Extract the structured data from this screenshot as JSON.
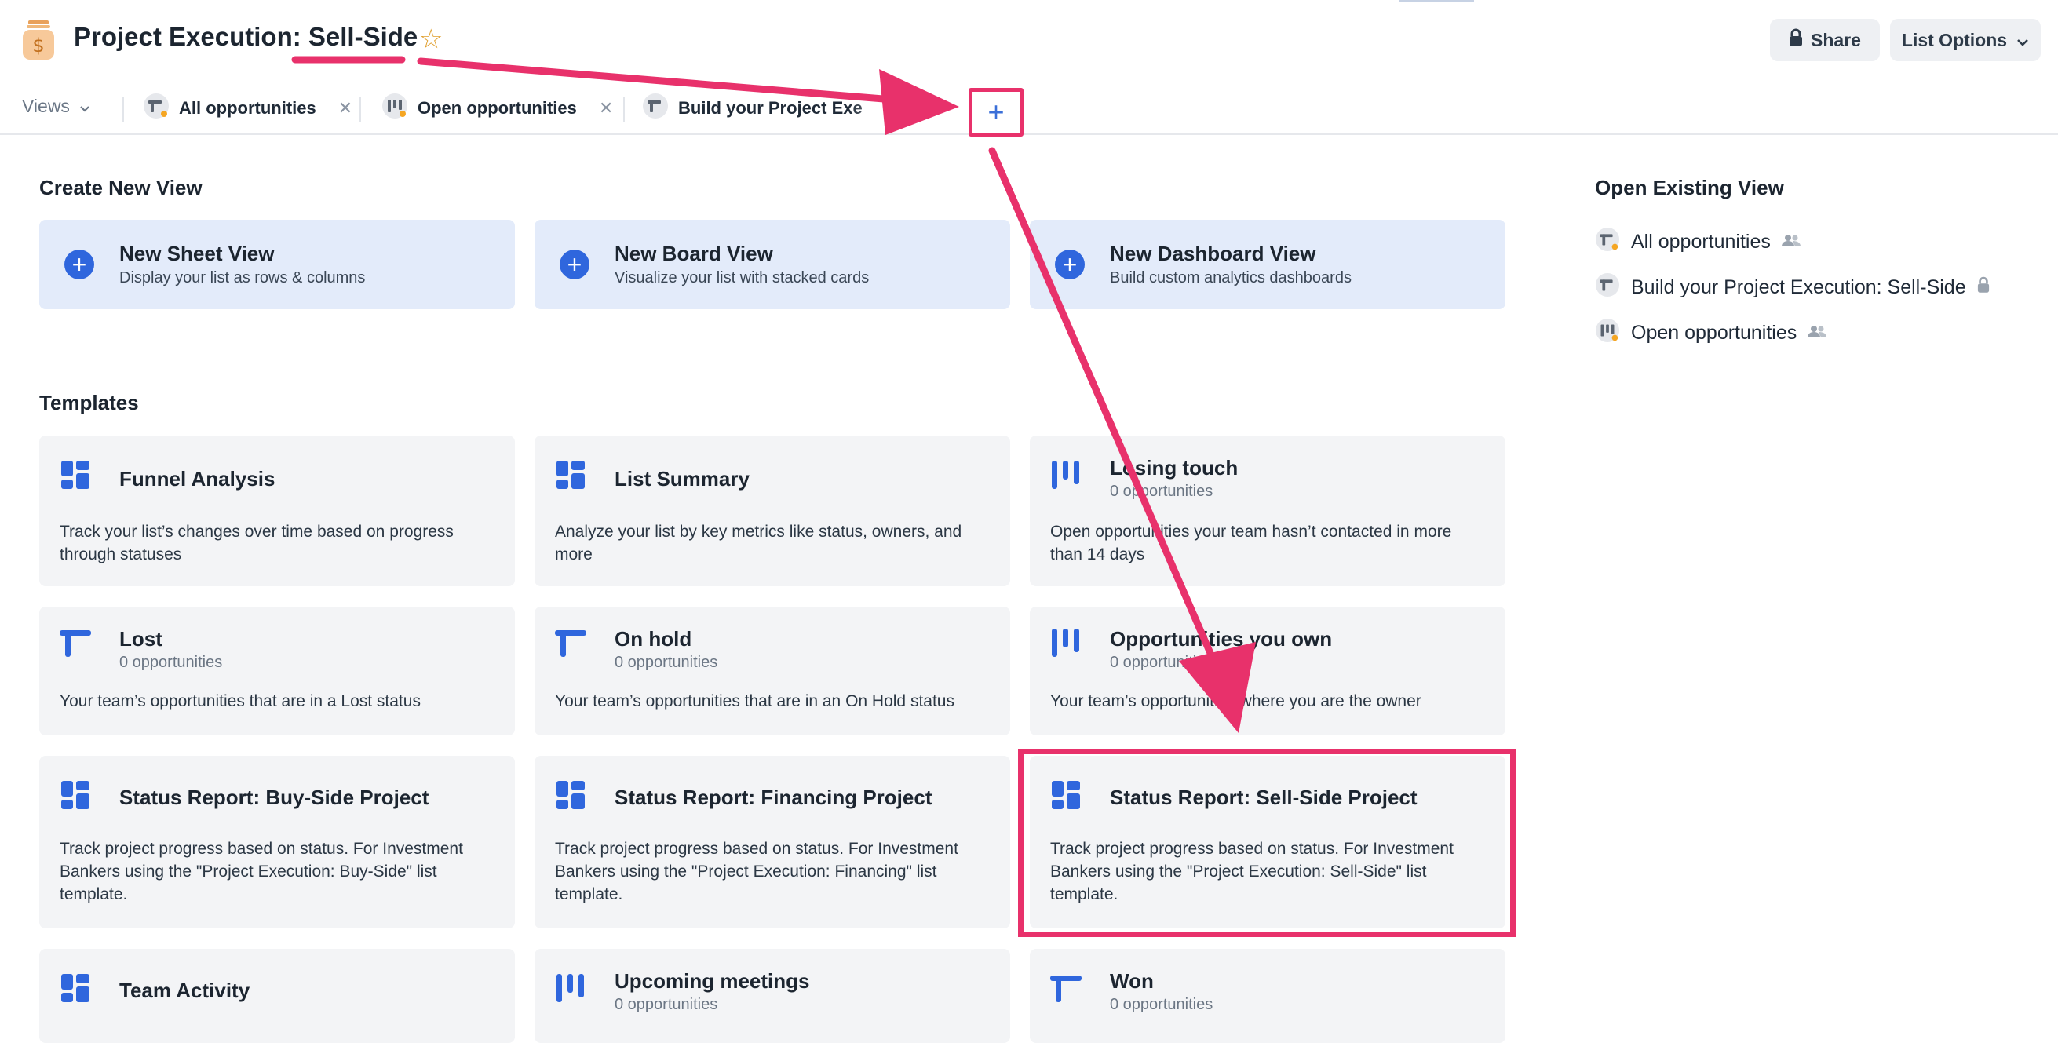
{
  "header": {
    "title": "Project Execution: Sell-Side",
    "share_label": "Share",
    "list_options_label": "List Options"
  },
  "views_bar": {
    "views_label": "Views",
    "tabs": [
      {
        "label": "All opportunities"
      },
      {
        "label": "Open opportunities"
      },
      {
        "label": "Build your Project Exe"
      }
    ],
    "add_label": "+"
  },
  "create": {
    "heading": "Create New View",
    "cards": [
      {
        "title": "New Sheet View",
        "subtitle": "Display your list as rows & columns"
      },
      {
        "title": "New Board View",
        "subtitle": "Visualize your list with stacked cards"
      },
      {
        "title": "New Dashboard View",
        "subtitle": "Build custom analytics dashboards"
      }
    ]
  },
  "existing": {
    "heading": "Open Existing View",
    "items": [
      {
        "label": "All opportunities",
        "access": "shared"
      },
      {
        "label": "Build your Project Execution: Sell-Side",
        "access": "private"
      },
      {
        "label": "Open opportunities",
        "access": "shared"
      }
    ]
  },
  "templates": {
    "heading": "Templates",
    "cards": [
      {
        "title": "Funnel Analysis",
        "count": "",
        "desc": "Track your list’s changes over time based on progress through statuses",
        "icon": "dashboard-icon"
      },
      {
        "title": "List Summary",
        "count": "",
        "desc": "Analyze your list by key metrics like status, owners, and more",
        "icon": "dashboard-icon"
      },
      {
        "title": "Losing touch",
        "count": "0 opportunities",
        "desc": "Open opportunities your team hasn’t contacted in more than 14 days",
        "icon": "board-icon"
      },
      {
        "title": "Lost",
        "count": "0 opportunities",
        "desc": "Your team’s opportunities that are in a Lost status",
        "icon": "sheet-icon"
      },
      {
        "title": "On hold",
        "count": "0 opportunities",
        "desc": "Your team’s opportunities that are in an On Hold status",
        "icon": "sheet-icon"
      },
      {
        "title": "Opportunities you own",
        "count": "0 opportunities",
        "desc": "Your team’s opportunities where you are the owner",
        "icon": "board-icon"
      },
      {
        "title": "Status Report: Buy-Side Project",
        "count": "",
        "desc": "Track project progress based on status. For Investment Bankers using the \"Project Execution: Buy-Side\" list template.",
        "icon": "dashboard-icon"
      },
      {
        "title": "Status Report: Financing Project",
        "count": "",
        "desc": "Track project progress based on status. For Investment Bankers using the \"Project Execution: Financing\" list template.",
        "icon": "dashboard-icon"
      },
      {
        "title": "Status Report: Sell-Side Project",
        "count": "",
        "desc": "Track project progress based on status. For Investment Bankers using the \"Project Execution: Sell-Side\" list template.",
        "icon": "dashboard-icon"
      },
      {
        "title": "Team Activity",
        "count": "",
        "desc": "",
        "icon": "dashboard-icon"
      },
      {
        "title": "Upcoming meetings",
        "count": "0 opportunities",
        "desc": "",
        "icon": "board-icon"
      },
      {
        "title": "Won",
        "count": "0 opportunities",
        "desc": "",
        "icon": "sheet-icon"
      }
    ]
  },
  "colors": {
    "accent": "#2f66dd",
    "annotation": "#e8316b",
    "card_bg": "#f3f4f6",
    "create_card_bg": "#e3ebfa"
  }
}
